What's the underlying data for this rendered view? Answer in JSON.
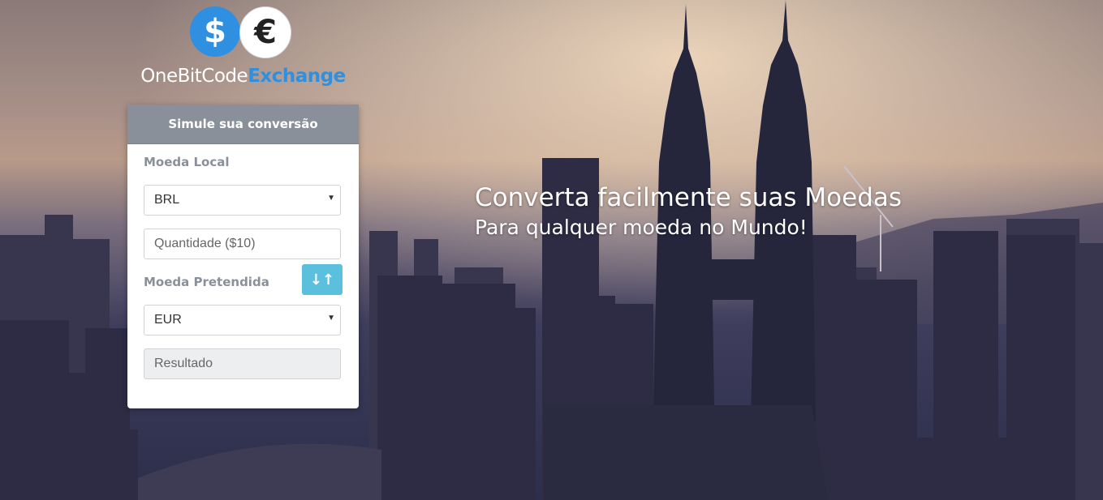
{
  "brand": {
    "dollar_symbol": "$",
    "euro_symbol": "€",
    "name_part1": "OneBitCode",
    "name_part2": "Exchange",
    "accent_color": "#2f8fe0"
  },
  "converter": {
    "title": "Simule sua conversão",
    "local_currency_label": "Moeda Local",
    "local_currency_value": "BRL",
    "quantity_placeholder": "Quantidade ($10)",
    "target_currency_label": "Moeda Pretendida",
    "target_currency_value": "EUR",
    "result_placeholder": "Resultado",
    "swap_icon": "swap-vertical-arrows-icon",
    "header_color": "#8a9099",
    "swap_button_color": "#5bc0de"
  },
  "hero": {
    "title": "Converta facilmente suas Moedas",
    "subtitle": "Para qualquer moeda no Mundo!"
  }
}
